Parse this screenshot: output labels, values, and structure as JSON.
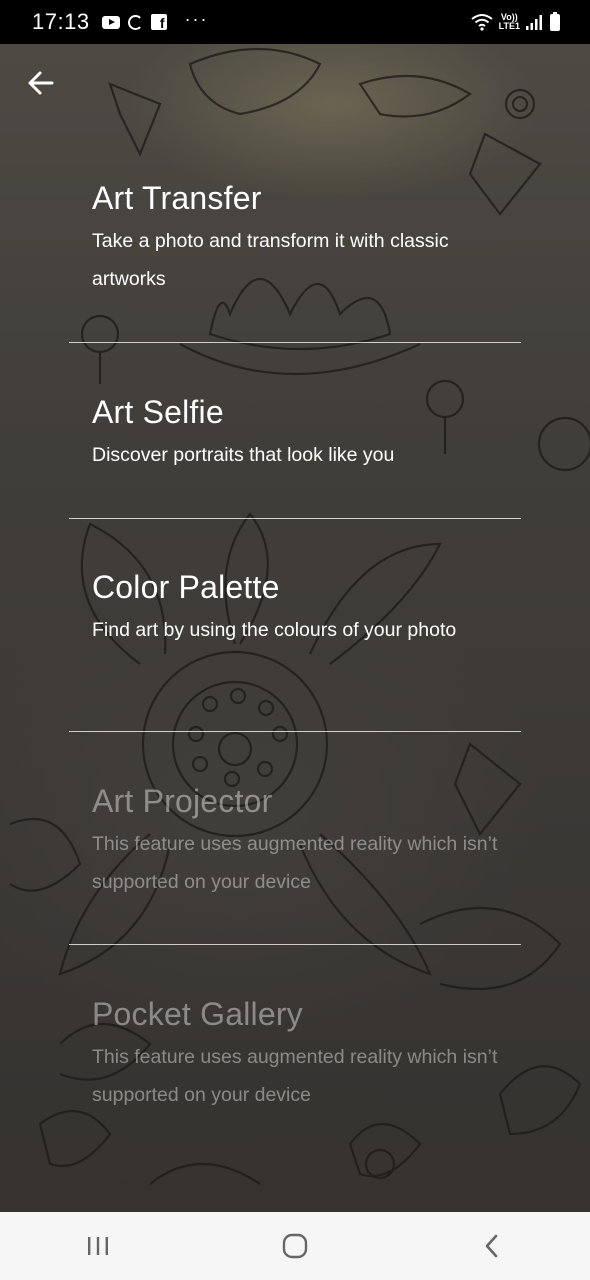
{
  "status_bar": {
    "time": "17:13",
    "dots": "···",
    "network_label_top": "Vo))",
    "network_label_bottom": "LTE1",
    "icons": [
      "youtube-icon",
      "g-icon",
      "facebook-icon",
      "wifi-icon",
      "signal-icon",
      "battery-icon"
    ]
  },
  "toolbar": {
    "back_icon": "arrow-left-icon"
  },
  "features": [
    {
      "title": "Art Transfer",
      "description": "Take a photo and transform it with classic artworks",
      "enabled": true
    },
    {
      "title": "Art Selfie",
      "description": "Discover portraits that look like you",
      "enabled": true
    },
    {
      "title": "Color Palette",
      "description": "Find art by using the colours of your photo",
      "enabled": true
    },
    {
      "title": "Art Projector",
      "description": "This feature uses augmented reality which isn’t supported on your device",
      "enabled": false
    },
    {
      "title": "Pocket Gallery",
      "description": "This feature uses augmented reality which isn’t supported on your device",
      "enabled": false
    }
  ],
  "nav_bar": {
    "icons": [
      "recent-apps-icon",
      "home-icon",
      "back-icon"
    ]
  },
  "colors": {
    "nav_bar_bg": "#f6f6f6",
    "status_bar_bg": "#000000",
    "text_primary": "#ffffff",
    "text_disabled": "#ffffff6b"
  }
}
